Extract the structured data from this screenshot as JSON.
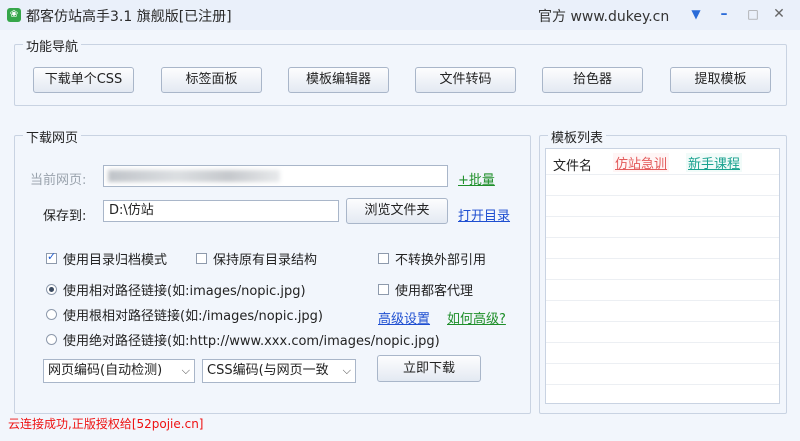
{
  "window": {
    "title": "都客仿站高手3.1 旗舰版[已注册]",
    "site": "官方 www.dukey.cn",
    "app_icon": "leaf-app-icon",
    "controls": {
      "dropdown": "▼",
      "minimize": "–",
      "maximize": "□",
      "close": "✕"
    }
  },
  "nav": {
    "label": "功能导航",
    "buttons": [
      "下载单个CSS",
      "标签面板",
      "模板编辑器",
      "文件转码",
      "拾色器",
      "提取模板"
    ]
  },
  "download": {
    "label": "下载网页",
    "current_page_label": "当前网页:",
    "current_page_value": "",
    "batch_link": "+批量",
    "save_to_label": "保存到:",
    "save_to_value": "D:\\仿站",
    "browse_button": "浏览文件夹",
    "open_dir_link": "打开目录",
    "options": {
      "use_dir_archive": {
        "label": "使用目录归档模式",
        "checked": true
      },
      "keep_dir_structure": {
        "label": "保持原有目录结构",
        "checked": false
      },
      "no_convert_external": {
        "label": "不转换外部引用",
        "checked": false
      },
      "use_proxy": {
        "label": "使用都客代理",
        "checked": false
      }
    },
    "path_modes": [
      {
        "label": "使用相对路径链接(如:images/nopic.jpg)",
        "checked": true
      },
      {
        "label": "使用根相对路径链接(如:/images/nopic.jpg)",
        "checked": false
      },
      {
        "label": "使用绝对路径链接(如:http://www.xxx.com/images/nopic.jpg)",
        "checked": false
      }
    ],
    "advanced_link": "高级设置",
    "how_advanced_link": "如何高级?",
    "page_encoding": "网页编码(自动检测)",
    "css_encoding": "CSS编码(与网页一致",
    "download_button": "立即下载"
  },
  "templates": {
    "label": "模板列表",
    "header": "文件名",
    "tag_1": "仿站急训",
    "tag_2": "新手课程"
  },
  "status": "云连接成功,正版授权给[52pojie.cn]",
  "colors": {
    "status": "#ee1111",
    "link_blue": "#1f4fd1",
    "link_green": "#1f8f2a"
  }
}
